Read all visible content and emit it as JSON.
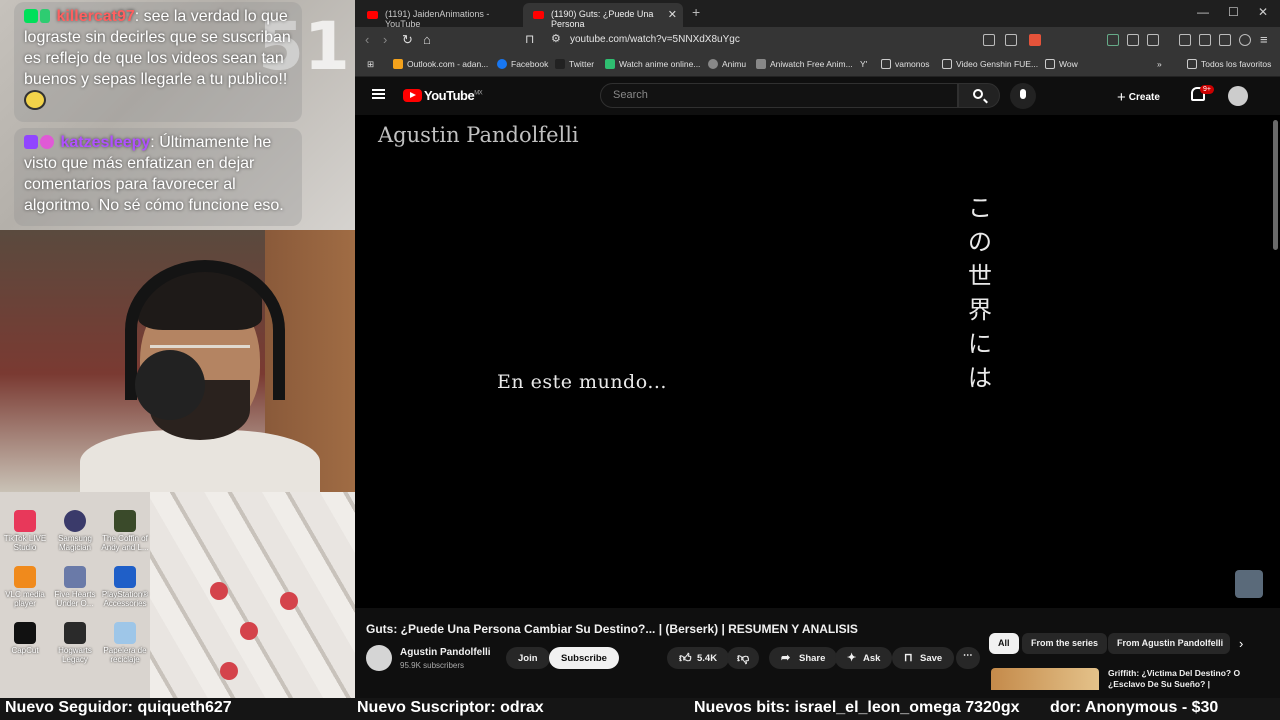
{
  "stream": {
    "chat_bg_number": "51",
    "messages": [
      {
        "user": "killercat97",
        "text": ": see la verdad lo que lograste sin decirles que se suscriban es reflejo de que los videos sean tan buenos y sepas llegarle a tu publico!!"
      },
      {
        "user": "katzesleepy",
        "text": ": Últimamente he visto que más enfatizan en dejar comentarios para favorecer al algoritmo. No sé cómo funcione eso."
      }
    ]
  },
  "desktop": {
    "icons": [
      {
        "label": "TikTok LIVE Studio",
        "color": "#e8385a"
      },
      {
        "label": "Samsung Magician",
        "color": "#3a3a6a"
      },
      {
        "label": "The Coffin of Andy and L...",
        "color": "#3a4a2a"
      },
      {
        "label": "VLC media player",
        "color": "#f08a1c"
      },
      {
        "label": "Five Hearts Under O...",
        "color": "#6a7aa8"
      },
      {
        "label": "PlayStation® Accessories",
        "color": "#1f5fc8"
      },
      {
        "label": "CapCut",
        "color": "#111111"
      },
      {
        "label": "Hogwarts Legacy",
        "color": "#2a2a2a"
      },
      {
        "label": "Papelera de reciclaje",
        "color": "#9ec6e8"
      }
    ]
  },
  "browser": {
    "tabs": [
      {
        "title": "(1191) JaidenAnimations - YouTube"
      },
      {
        "title": "(1190) Guts: ¿Puede Una Persona"
      }
    ],
    "url": "youtube.com/watch?v=5NNXdX8uYgc",
    "bookmarks": [
      {
        "label": "Outlook.com - adan...",
        "color": "#f4a21c"
      },
      {
        "label": "Facebook",
        "color": "#1877f2"
      },
      {
        "label": "Twitter",
        "color": "#222222"
      },
      {
        "label": "Watch anime online...",
        "color": "#2fbf71"
      },
      {
        "label": "Animu",
        "color": "#888888"
      },
      {
        "label": "Aniwatch Free Anim...",
        "color": "#888888"
      },
      {
        "label": "vamonos",
        "color": "#888888"
      },
      {
        "label": "Video Genshin FUE...",
        "color": "#888888"
      },
      {
        "label": "Wow",
        "color": "#888888"
      },
      {
        "label": "Todos los favoritos",
        "color": "#888888"
      }
    ]
  },
  "youtube": {
    "logo": "YouTube",
    "region": "MX",
    "search_placeholder": "Search",
    "create_label": "Create",
    "notif_count": "9+",
    "player": {
      "watermark": "Agustin Pandolfelli",
      "jp_lines": [
        "こ",
        "の",
        "世",
        "界",
        "に",
        "は"
      ],
      "subtitle": "En este mundo..."
    },
    "video_title": "Guts: ¿Puede Una Persona Cambiar Su Destino?... | (Berserk) | RESUMEN Y ANALISIS",
    "channel_name": "Agustin Pandolfelli",
    "subscribers": "95.9K subscribers",
    "join_label": "Join",
    "subscribe_label": "Subscribe",
    "likes": "5.4K",
    "share_label": "Share",
    "ask_label": "Ask",
    "save_label": "Save",
    "chips": [
      "All",
      "From the series",
      "From Agustin Pandolfelli"
    ],
    "rec_title": "Griffith: ¿Victima Del Destino? O ¿Esclavo De Su Sueño? |"
  },
  "ticker": {
    "follower": "Nuevo Seguidor: quiqueth627",
    "subscriber": "Nuevo Suscriptor: odrax",
    "bits": "Nuevos bits: israel_el_leon_omega 7320gx",
    "donation": "dor: Anonymous - $30"
  }
}
